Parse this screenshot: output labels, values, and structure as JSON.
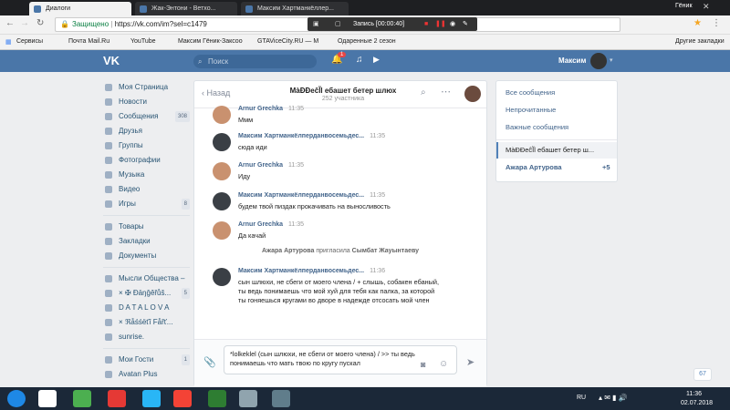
{
  "browser": {
    "tabs": [
      {
        "label": "Диалоги"
      },
      {
        "label": "Жак-Энтони - Ветхо..."
      },
      {
        "label": "Максим Хартманкёллер..."
      }
    ],
    "secure_label": "Защищено",
    "url": "https://vk.com/im?sel=c1479",
    "recording": "Запись [00:00:40]",
    "window_user": "Гёник",
    "bookmarks": [
      "Сервисы",
      "Почта Mail.Ru",
      "YouTube",
      "Максим Гёник-Заксоо",
      "GTAViceCity.RU — М",
      "Одаренные 2 сезон"
    ],
    "other_bookmarks": "Другие закладки"
  },
  "vk": {
    "search_placeholder": "Поиск",
    "user_name": "Максим",
    "notif_count": "1",
    "sidebar": [
      {
        "label": "Моя Страница",
        "count": ""
      },
      {
        "label": "Новости",
        "count": ""
      },
      {
        "label": "Сообщения",
        "count": "308"
      },
      {
        "label": "Друзья",
        "count": ""
      },
      {
        "label": "Группы",
        "count": ""
      },
      {
        "label": "Фотографии",
        "count": ""
      },
      {
        "label": "Музыка",
        "count": ""
      },
      {
        "label": "Видео",
        "count": ""
      },
      {
        "label": "Игры",
        "count": "8"
      }
    ],
    "sidebar2": [
      {
        "label": "Товары"
      },
      {
        "label": "Закладки"
      },
      {
        "label": "Документы"
      }
    ],
    "sidebar3": [
      {
        "label": "Мысли Общества –",
        "count": ""
      },
      {
        "label": "× ✠ Ðāŋĝêřůš...",
        "count": "5"
      },
      {
        "label": "D A T A L O V A",
        "count": ""
      },
      {
        "label": "× ℜåśśëťî Fåřť...",
        "count": ""
      },
      {
        "label": "sunrise.",
        "count": ""
      }
    ],
    "sidebar4": [
      {
        "label": "Мои Гости",
        "count": "1"
      },
      {
        "label": "Avatan Plus",
        "count": ""
      }
    ],
    "chat": {
      "back_label": "Назад",
      "title": "MàĐĐeĉĨl ебашет бетер шлюх",
      "subtitle": "252 участника",
      "messages": [
        {
          "name": "Arnur Grechka",
          "time": "11:35",
          "text": "Ммм",
          "avatar": "#c9916f"
        },
        {
          "name": "Максим Хартманкёлперданвосемьдес...",
          "time": "11:35",
          "text": "сюда иди",
          "avatar": "#3a3f45"
        },
        {
          "name": "Arnur Grechka",
          "time": "11:35",
          "text": "Иду",
          "avatar": "#c9916f"
        },
        {
          "name": "Максим Хартманкёлперданвосемьдес...",
          "time": "11:35",
          "text": "будем твой пиздак прокачивать на выносливость",
          "avatar": "#3a3f45"
        },
        {
          "name": "Arnur Grechka",
          "time": "11:35",
          "text": "Да качай",
          "avatar": "#c9916f"
        },
        {
          "name": "Максим Хартманкёлперданвосемьдес...",
          "time": "11:36",
          "text": "сын шлюхи, не сбеги от моего члена / + слышь, собакен ебаный, ты ведь понимаешь что мой хуй для тебя как палка, за которой ты гоняешься кругами во дворе в надежде отсосать мой член",
          "avatar": "#3a3f45"
        }
      ],
      "system": {
        "actor": "Ажара Артурова",
        "action": "пригласила",
        "target": "Сымбат Жауынтаеву"
      },
      "input": "*lolkeklel (сын шлюхи, не сбеги от моего члена) / >> ты ведь понимаешь что мать твою по кругу пускал"
    },
    "right_panel": {
      "items": [
        "Все сообщения",
        "Непрочитанные",
        "Важные сообщения"
      ],
      "active_chat": "MàĐĐeĉĨl ебашет бетер ш...",
      "other_chat": "Ажара Артурова",
      "other_count": "+5"
    },
    "online_count": "67"
  },
  "taskbar": {
    "lang": "RU",
    "time": "11:36",
    "date": "02.07.2018"
  }
}
